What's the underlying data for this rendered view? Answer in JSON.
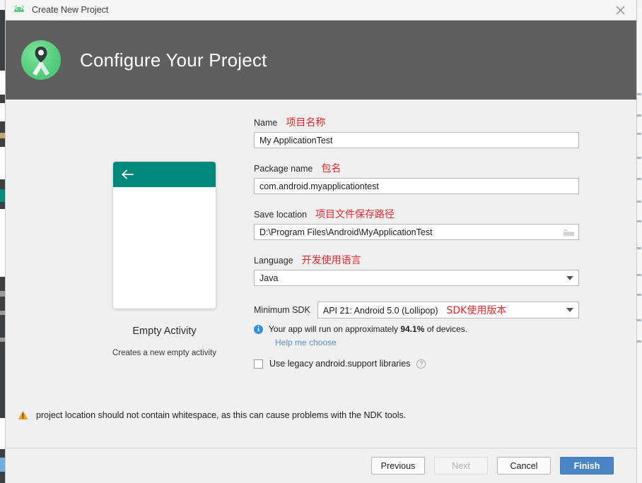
{
  "window": {
    "title": "Create New Project",
    "app_icon": "android-robot-icon",
    "close_icon": "close-icon"
  },
  "header": {
    "title": "Configure Your Project",
    "logo": "android-studio-logo",
    "background_color": "#5f5f5f"
  },
  "preview": {
    "template_name": "Empty Activity",
    "description": "Creates a new empty activity",
    "appbar_color": "#00897b",
    "back_icon": "arrow-left-icon"
  },
  "form": {
    "name": {
      "label": "Name",
      "annotation": "项目名称",
      "value": "My ApplicationTest"
    },
    "package_name": {
      "label": "Package name",
      "annotation": "包名",
      "value": "com.android.myapplicationtest"
    },
    "save_location": {
      "label": "Save location",
      "annotation": "项目文件保存路径",
      "value": "D:\\Program Files\\Android\\MyApplicationTest",
      "browse_icon": "folder-icon"
    },
    "language": {
      "label": "Language",
      "annotation": "开发使用语言",
      "value": "Java",
      "dropdown_icon": "chevron-down-icon"
    },
    "minimum_sdk": {
      "label": "Minimum SDK",
      "annotation": "SDK使用版本",
      "value": "API 21: Android 5.0 (Lollipop)",
      "dropdown_icon": "chevron-down-icon"
    },
    "sdk_info": {
      "icon": "info-icon",
      "text_before": "Your app will run on approximately ",
      "percent": "94.1%",
      "text_after": " of devices.",
      "link": "Help me choose",
      "link_color": "#5b8fc9"
    },
    "legacy_libraries": {
      "label": "Use legacy android.support libraries",
      "checked": false,
      "help_icon": "question-mark-icon"
    }
  },
  "warning": {
    "icon": "warning-triangle-icon",
    "text": "project location should not contain whitespace, as this can cause problems with the NDK tools.",
    "color": "#e8a317"
  },
  "footer": {
    "previous": "Previous",
    "next": "Next",
    "cancel": "Cancel",
    "finish": "Finish",
    "finish_color": "#4a86c5"
  },
  "annotation_color": "#e8262a"
}
